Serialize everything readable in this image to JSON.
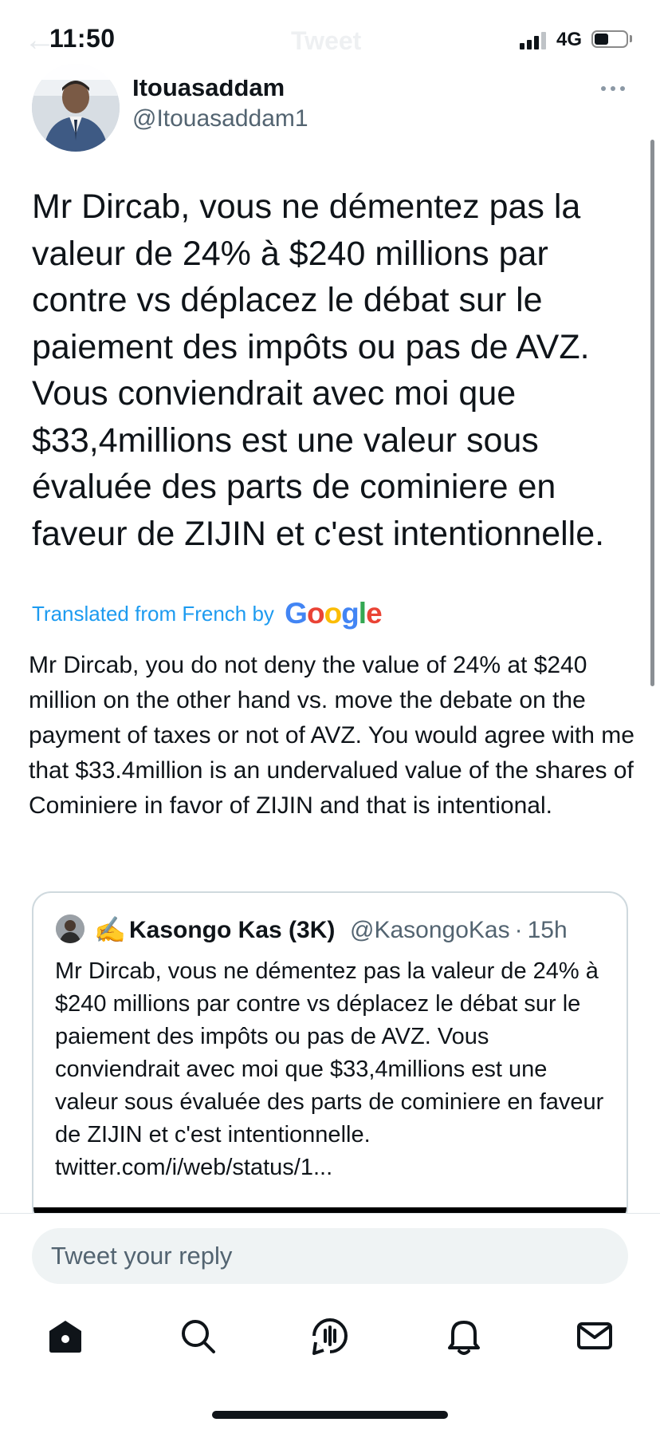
{
  "status_bar": {
    "time": "11:50",
    "network": "4G",
    "battery_level": 0.45
  },
  "header": {
    "back_icon": "arrow-left-icon",
    "title": "Tweet"
  },
  "tweet": {
    "author_name": "Itouasaddam",
    "author_handle": "@Itouasaddam1",
    "more_icon": "more-horizontal-icon",
    "text": "Mr Dircab, vous ne démentez pas la valeur de 24% à $240 millions par contre vs déplacez le débat sur le paiement des impôts ou pas de AVZ. Vous conviendrait avec moi que $33,4millions est une valeur sous évaluée des parts de cominiere en faveur de ZIJIN et c'est intentionnelle.",
    "translated_label": "Translated from French by",
    "translator_brand": "Google",
    "translation": "Mr Dircab, you do not deny the value of 24% at $240 million on the other hand vs. move the debate on the payment of taxes or not of AVZ. You would agree with me that $33.4million is an undervalued value of the shares of Cominiere in favor of ZIJIN and that is intentional."
  },
  "quoted_tweet": {
    "emoji": "✍️",
    "author_name": "Kasongo Kas (3K)",
    "author_handle": "@KasongoKas",
    "separator": "·",
    "time": "15h",
    "text": "Mr Dircab, vous ne démentez pas la valeur de 24% à $240 millions par contre vs déplacez le débat sur le paiement des impôts ou pas de AVZ. Vous conviendrait avec moi que $33,4millions est une valeur sous évaluée des parts de cominiere en faveur de ZIJIN et c'est intentionnelle. twitter.com/i/web/status/1..."
  },
  "reply": {
    "placeholder": "Tweet your reply"
  },
  "tab_bar": {
    "items": [
      "home-icon",
      "search-icon",
      "spaces-icon",
      "notifications-icon",
      "messages-icon"
    ]
  },
  "colors": {
    "accent": "#1d9bf0",
    "text": "#0f1419",
    "secondary": "#536471"
  }
}
